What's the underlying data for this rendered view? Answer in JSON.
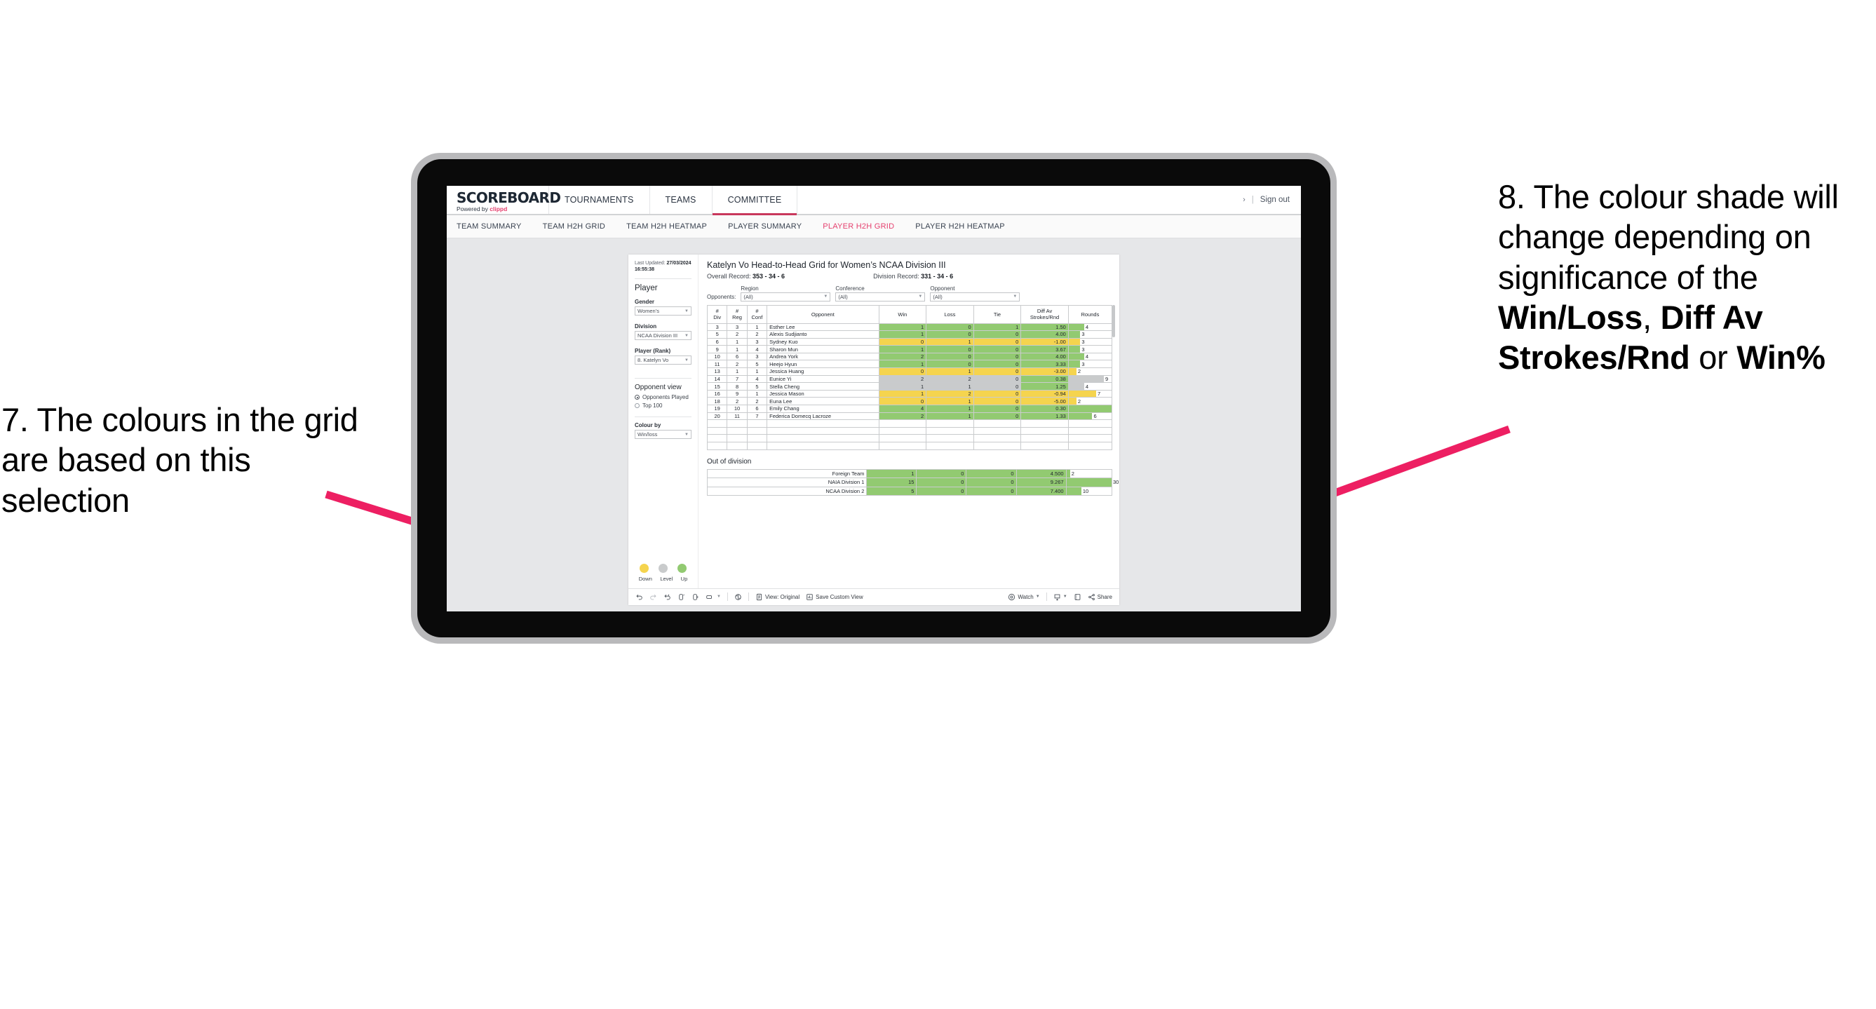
{
  "annotations": {
    "left": "7. The colours in the grid are based on this selection",
    "right_pre": "8. The colour shade will change depending on significance of the ",
    "right_b1": "Win/Loss",
    "right_mid1": ", ",
    "right_b2": "Diff Av Strokes/Rnd",
    "right_mid2": " or ",
    "right_b3": "Win%",
    "arrow_color": "#ed1f62"
  },
  "app": {
    "brand": {
      "title": "SCOREBOARD",
      "powered_prefix": "Powered by ",
      "powered_brand": "clippd"
    },
    "main_nav": [
      {
        "label": "TOURNAMENTS",
        "active": false
      },
      {
        "label": "TEAMS",
        "active": false
      },
      {
        "label": "COMMITTEE",
        "active": true
      }
    ],
    "top_right": {
      "chevron": "›",
      "separator": "|",
      "sign_out": "Sign out"
    },
    "sub_nav": [
      {
        "label": "TEAM SUMMARY",
        "active": false
      },
      {
        "label": "TEAM H2H GRID",
        "active": false
      },
      {
        "label": "TEAM H2H HEATMAP",
        "active": false
      },
      {
        "label": "PLAYER SUMMARY",
        "active": false
      },
      {
        "label": "PLAYER H2H GRID",
        "active": true
      },
      {
        "label": "PLAYER H2H HEATMAP",
        "active": false
      }
    ]
  },
  "sidebar": {
    "last_updated_label": "Last Updated: ",
    "last_updated_value": "27/03/2024 16:55:38",
    "player_heading": "Player",
    "filters": [
      {
        "label": "Gender",
        "value": "Women’s"
      },
      {
        "label": "Division",
        "value": "NCAA Division III"
      },
      {
        "label": "Player (Rank)",
        "value": "8. Katelyn Vo"
      }
    ],
    "opponent_view": {
      "heading": "Opponent view",
      "options": [
        {
          "label": "Opponents Played",
          "selected": true
        },
        {
          "label": "Top 100",
          "selected": false
        }
      ]
    },
    "colour_by": {
      "label": "Colour by",
      "value": "Win/loss"
    },
    "legend": [
      {
        "label": "Down",
        "color": "#f5d44e"
      },
      {
        "label": "Level",
        "color": "#c9cbcc"
      },
      {
        "label": "Up",
        "color": "#92ca71"
      }
    ]
  },
  "main": {
    "title": "Katelyn Vo Head-to-Head Grid for Women’s NCAA Division III",
    "overall_record_label": "Overall Record: ",
    "overall_record_value": "353 -  34 - 6",
    "division_record_label": "Division Record: ",
    "division_record_value": "331 -  34 - 6",
    "opponents_label": "Opponents:",
    "opponent_filters": [
      {
        "label": "Region",
        "value": "(All)"
      },
      {
        "label": "Conference",
        "value": "(All)"
      },
      {
        "label": "Opponent",
        "value": "(All)"
      }
    ],
    "out_of_division_title": "Out of division"
  },
  "chart_data": {
    "type": "table",
    "title": "Katelyn Vo Head-to-Head Grid for Women’s NCAA Division III",
    "columns": [
      "# Div",
      "# Reg",
      "# Conf",
      "Opponent",
      "Win",
      "Loss",
      "Tie",
      "Diff Av Strokes/Rnd",
      "Rounds"
    ],
    "header_lines": [
      [
        "#",
        "Div"
      ],
      [
        "#",
        "Reg"
      ],
      [
        "#",
        "Conf"
      ],
      [
        "Opponent"
      ],
      [
        "Win"
      ],
      [
        "Loss"
      ],
      [
        "Tie"
      ],
      [
        "Diff Av",
        "Strokes/Rnd"
      ],
      [
        "Rounds"
      ]
    ],
    "rounds_max": 11,
    "rows": [
      {
        "div": "3",
        "reg": "3",
        "conf": "1",
        "opponent": "Esther Lee",
        "win": "1",
        "loss": "0",
        "tie": "1",
        "diff": "1.50",
        "rounds": "4",
        "rounds_n": 4,
        "color": "g"
      },
      {
        "div": "5",
        "reg": "2",
        "conf": "2",
        "opponent": "Alexis Sudjianto",
        "win": "1",
        "loss": "0",
        "tie": "0",
        "diff": "4.00",
        "rounds": "3",
        "rounds_n": 3,
        "color": "g"
      },
      {
        "div": "6",
        "reg": "1",
        "conf": "3",
        "opponent": "Sydney Kuo",
        "win": "0",
        "loss": "1",
        "tie": "0",
        "diff": "-1.00",
        "rounds": "3",
        "rounds_n": 3,
        "color": "y"
      },
      {
        "div": "9",
        "reg": "1",
        "conf": "4",
        "opponent": "Sharon Mun",
        "win": "1",
        "loss": "0",
        "tie": "0",
        "diff": "3.67",
        "rounds": "3",
        "rounds_n": 3,
        "color": "g"
      },
      {
        "div": "10",
        "reg": "6",
        "conf": "3",
        "opponent": "Andrea York",
        "win": "2",
        "loss": "0",
        "tie": "0",
        "diff": "4.00",
        "rounds": "4",
        "rounds_n": 4,
        "color": "g"
      },
      {
        "div": "11",
        "reg": "2",
        "conf": "5",
        "opponent": "Heejo Hyun",
        "win": "1",
        "loss": "0",
        "tie": "0",
        "diff": "3.33",
        "rounds": "3",
        "rounds_n": 3,
        "color": "g"
      },
      {
        "div": "13",
        "reg": "1",
        "conf": "1",
        "opponent": "Jessica Huang",
        "win": "0",
        "loss": "1",
        "tie": "0",
        "diff": "-3.00",
        "rounds": "2",
        "rounds_n": 2,
        "color": "y"
      },
      {
        "div": "14",
        "reg": "7",
        "conf": "4",
        "opponent": "Eunice Yi",
        "win": "2",
        "loss": "2",
        "tie": "0",
        "diff": "0.38",
        "rounds": "9",
        "rounds_n": 9,
        "color": "gr",
        "diff_color": "g"
      },
      {
        "div": "15",
        "reg": "8",
        "conf": "5",
        "opponent": "Stella Cheng",
        "win": "1",
        "loss": "1",
        "tie": "0",
        "diff": "1.25",
        "rounds": "4",
        "rounds_n": 4,
        "color": "gr",
        "diff_color": "g"
      },
      {
        "div": "16",
        "reg": "9",
        "conf": "1",
        "opponent": "Jessica Mason",
        "win": "1",
        "loss": "2",
        "tie": "0",
        "diff": "-0.94",
        "rounds": "7",
        "rounds_n": 7,
        "color": "y"
      },
      {
        "div": "18",
        "reg": "2",
        "conf": "2",
        "opponent": "Euna Lee",
        "win": "0",
        "loss": "1",
        "tie": "0",
        "diff": "-5.00",
        "rounds": "2",
        "rounds_n": 2,
        "color": "y"
      },
      {
        "div": "19",
        "reg": "10",
        "conf": "6",
        "opponent": "Emily Chang",
        "win": "4",
        "loss": "1",
        "tie": "0",
        "diff": "0.30",
        "rounds": "11",
        "rounds_n": 11,
        "color": "g"
      },
      {
        "div": "20",
        "reg": "11",
        "conf": "7",
        "opponent": "Federica Domecq Lacroze",
        "win": "2",
        "loss": "1",
        "tie": "0",
        "diff": "1.33",
        "rounds": "6",
        "rounds_n": 6,
        "color": "g"
      }
    ],
    "out_of_division": {
      "rounds_max": 30,
      "rows": [
        {
          "label": "Foreign Team",
          "win": "1",
          "loss": "0",
          "tie": "0",
          "diff": "4.500",
          "rounds": "2",
          "rounds_n": 2,
          "color": "g"
        },
        {
          "label": "NAIA Division 1",
          "win": "15",
          "loss": "0",
          "tie": "0",
          "diff": "9.267",
          "rounds": "30",
          "rounds_n": 30,
          "color": "g"
        },
        {
          "label": "NCAA Division 2",
          "win": "5",
          "loss": "0",
          "tie": "0",
          "diff": "7.400",
          "rounds": "10",
          "rounds_n": 10,
          "color": "g"
        }
      ]
    }
  },
  "toolbar": {
    "view_label": "View: Original",
    "save_label": "Save Custom View",
    "watch_label": "Watch",
    "share_label": "Share"
  }
}
